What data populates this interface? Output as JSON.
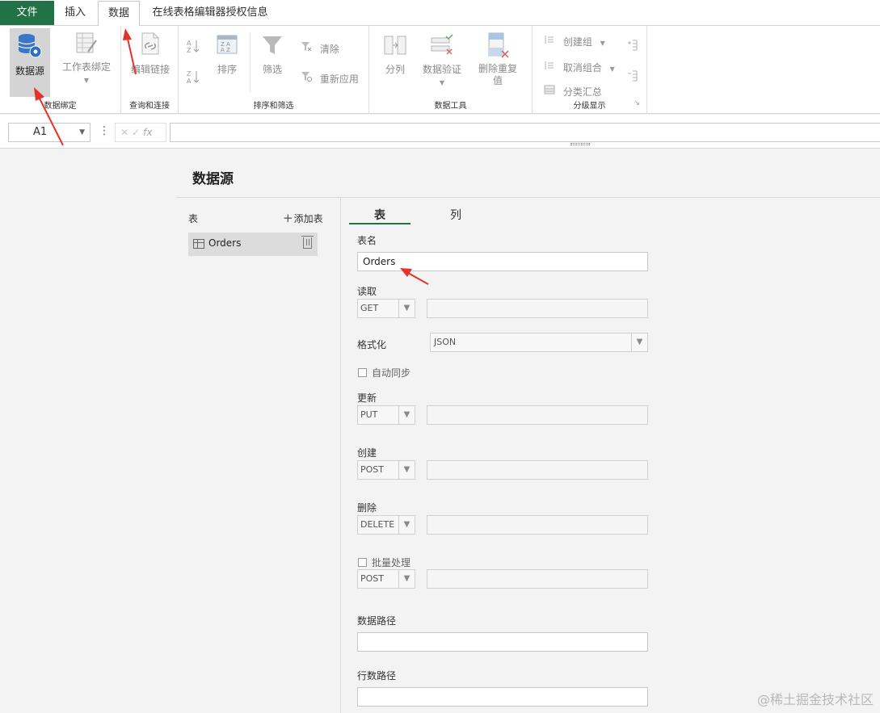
{
  "tabs": {
    "file": "文件",
    "insert": "插入",
    "data": "数据",
    "license": "在线表格编辑器授权信息"
  },
  "ribbon": {
    "groups": {
      "binding": "数据绑定",
      "query": "查询和连接",
      "sort_filter": "排序和筛选",
      "tools": "数据工具",
      "outline": "分级显示"
    },
    "buttons": {
      "data_source": "数据源",
      "sheet_binding": "工作表绑定",
      "edit_link": "编辑链接",
      "sort": "排序",
      "filter": "筛选",
      "clear": "清除",
      "reapply": "重新应用",
      "split_column": "分列",
      "data_validation": "数据验证",
      "remove_dup_1": "删除重复",
      "remove_dup_2": "值",
      "group": "创建组",
      "ungroup": "取消组合",
      "subtotal": "分类汇总"
    }
  },
  "formula_bar": {
    "cell_ref": "A1",
    "fx": "fx"
  },
  "panel": {
    "title": "数据源",
    "table_list_label": "表",
    "add_table": "添加表",
    "tables": [
      {
        "name": "Orders"
      }
    ],
    "tabs": [
      "表",
      "列"
    ],
    "table_name_label": "表名",
    "table_name_value": "Orders",
    "read_label": "读取",
    "read_method": "GET",
    "format_label": "格式化",
    "format_value": "JSON",
    "auto_sync_label": "自动同步",
    "update_label": "更新",
    "update_method": "PUT",
    "create_label": "创建",
    "create_method": "POST",
    "delete_label": "删除",
    "delete_method": "DELETE",
    "batch_label": "批量处理",
    "batch_method": "POST",
    "data_path_label": "数据路径",
    "row_count_path_label": "行数路径"
  },
  "colors": {
    "accent": "#217346",
    "arrow": "#e5322d"
  },
  "watermark": "@稀土掘金技术社区"
}
